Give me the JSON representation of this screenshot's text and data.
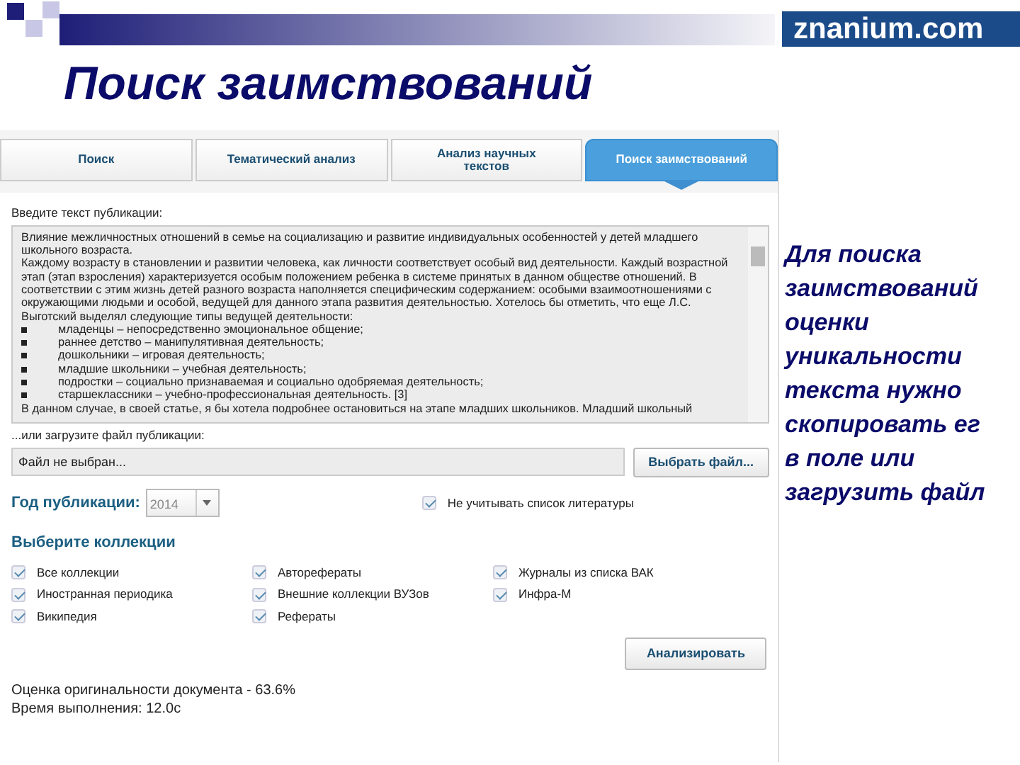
{
  "slide": {
    "title": "Поиск заимствований",
    "logo": "znanium.com"
  },
  "tabs": [
    {
      "label": "Поиск",
      "selected": false
    },
    {
      "label": "Тематический анализ",
      "selected": false
    },
    {
      "label": "Анализ научных текстов",
      "selected": false
    },
    {
      "label": "Поиск заимствований",
      "selected": true
    }
  ],
  "text_input": {
    "label": "Введите текст публикации:",
    "paragraphs": [
      "Влияние межличностных отношений в семье на социализацию и развитие индивидуальных особенностей у детей младшего школьного возраста.",
      "Каждому возрасту в становлении и развитии человека, как личности соответствует особый вид деятельности. Каждый возрастной этап (этап взросления) характеризуется особым положением ребенка в системе принятых в данном обществе отношений. В соответствии с этим жизнь детей разного возраста наполняется специфическим содержанием: особыми взаимоотношениями с окружающими людьми и особой, ведущей для данного этапа развития деятельностью. Хотелось бы отметить, что еще Л.С. Выготский выделял следующие типы ведущей деятельности:"
    ],
    "bullets": [
      "младенцы – непосредственно эмоциональное общение;",
      "раннее детство – манипулятивная деятельность;",
      "дошкольники – игровая деятельность;",
      "младшие школьники – учебная деятельность;",
      "подростки – социально признаваемая и социально одобряемая деятельность;",
      "старшеклассники – учебно-профессиональная деятельность. [3]"
    ],
    "tail": "В данном случае, в своей статье, я бы хотела подробнее остановиться на этапе младших школьников. Младший школьный"
  },
  "file_upload": {
    "label": "...или загрузите файл публикации:",
    "value": "Файл не выбран...",
    "button": "Выбрать файл..."
  },
  "year": {
    "label": "Год публикации:",
    "value": "2014"
  },
  "exclude_references": {
    "label": "Не учитывать список литературы",
    "checked": true
  },
  "collections": {
    "title": "Выберите коллекции",
    "columns": [
      [
        {
          "label": "Все коллекции",
          "checked": true
        },
        {
          "label": "Иностранная периодика",
          "checked": true
        },
        {
          "label": "Википедия",
          "checked": true
        }
      ],
      [
        {
          "label": "Авторефераты",
          "checked": true
        },
        {
          "label": "Внешние коллекции ВУЗов",
          "checked": true
        },
        {
          "label": "Рефераты",
          "checked": true
        }
      ],
      [
        {
          "label": "Журналы из списка ВАК",
          "checked": true
        },
        {
          "label": "Инфра-М",
          "checked": true
        }
      ]
    ]
  },
  "analyze_button": "Анализировать",
  "results": [
    "Оценка оригинальности документа - 63.6%",
    "Время выполнения: 12.0с"
  ],
  "note": {
    "lines": [
      "Для поиска",
      "заимствований",
      "оценки",
      "уникальности",
      "текста нужно",
      "скопировать ег",
      "в поле или",
      "загрузить файл"
    ]
  }
}
